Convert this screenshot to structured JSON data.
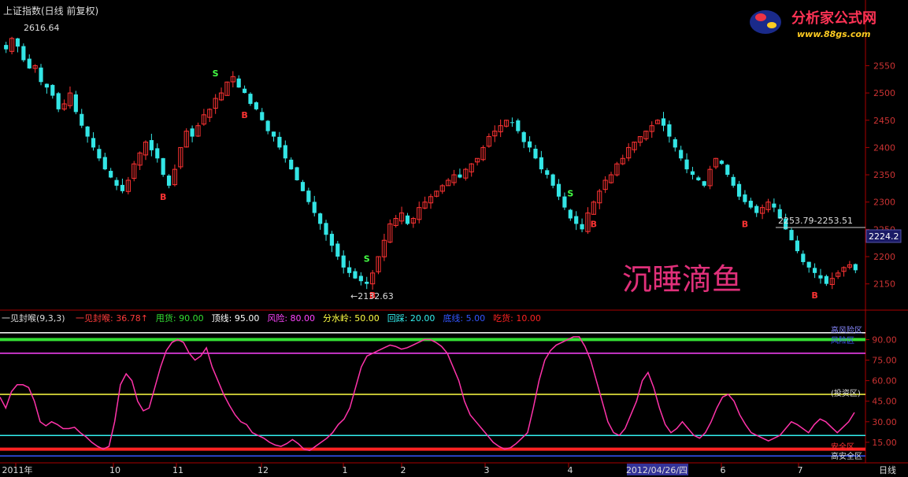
{
  "main": {
    "title": "上证指数(日线 前复权)",
    "high_label": "2616.64",
    "low_label": "←2132.63",
    "crosshair_label": "2253.79-2253.51",
    "current_value": "2224.2",
    "watermark": "沉睡滴鱼"
  },
  "logo": {
    "name": "分析家公式网",
    "url": "www.88gs.com"
  },
  "indicator": {
    "name": "一见封喉(9,3,3)",
    "legend": [
      {
        "label": "一见封喉: 36.78",
        "color": "#ff3b3b",
        "arrow": "↑"
      },
      {
        "label": "甩货: 90.00",
        "color": "#33dd33"
      },
      {
        "label": "顶线: 95.00",
        "color": "#ffffff"
      },
      {
        "label": "风险: 80.00",
        "color": "#ff44ff"
      },
      {
        "label": "分水岭: 50.00",
        "color": "#ffff44"
      },
      {
        "label": "回踩: 20.00",
        "color": "#33eeee"
      },
      {
        "label": "底线: 5.00",
        "color": "#3355ff"
      },
      {
        "label": "吃货: 10.00",
        "color": "#ff2222"
      }
    ],
    "zone_labels": {
      "high_risk": "高风险区",
      "risk": "风险区",
      "invest": "(投资区)",
      "safe": "安全区",
      "high_safe": "高安全区"
    }
  },
  "colors": {
    "up": "#ff3333",
    "down": "#33e5e5",
    "axis": "#aa0000",
    "oscillator": "#ff33aa"
  },
  "chart_data": [
    {
      "type": "candlestick",
      "title": "上证指数(日线 前复权)",
      "ylim": [
        2125,
        2630
      ],
      "yticks": [
        2150,
        2200,
        2250,
        2300,
        2350,
        2400,
        2450,
        2500,
        2550
      ],
      "ytick_labels": [
        "2150",
        "2200",
        "2250",
        "2300",
        "2350",
        "2400",
        "2450",
        "2500",
        "2550"
      ],
      "grid": false,
      "annotations": {
        "high": 2616.64,
        "low": 2132.63,
        "current": 2224.2,
        "crosshair": [
          2253.79,
          2253.51
        ]
      },
      "signals": [
        {
          "type": "S",
          "color": "#44ff44"
        },
        {
          "type": "B",
          "color": "#ff3333"
        }
      ],
      "close": [
        2580,
        2600,
        2585,
        2560,
        2545,
        2550,
        2520,
        2510,
        2495,
        2470,
        2480,
        2500,
        2465,
        2440,
        2420,
        2400,
        2380,
        2360,
        2345,
        2330,
        2320,
        2340,
        2370,
        2390,
        2410,
        2395,
        2380,
        2350,
        2330,
        2360,
        2400,
        2430,
        2420,
        2440,
        2460,
        2470,
        2490,
        2500,
        2520,
        2530,
        2510,
        2500,
        2480,
        2470,
        2450,
        2430,
        2420,
        2400,
        2380,
        2360,
        2340,
        2320,
        2300,
        2280,
        2260,
        2240,
        2220,
        2200,
        2180,
        2170,
        2160,
        2155,
        2150,
        2170,
        2200,
        2230,
        2260,
        2270,
        2280,
        2260,
        2270,
        2290,
        2300,
        2310,
        2320,
        2330,
        2340,
        2350,
        2345,
        2360,
        2370,
        2380,
        2400,
        2420,
        2430,
        2440,
        2450,
        2445,
        2430,
        2410,
        2400,
        2380,
        2360,
        2350,
        2330,
        2310,
        2290,
        2270,
        2260,
        2250,
        2280,
        2300,
        2320,
        2340,
        2350,
        2370,
        2380,
        2400,
        2410,
        2420,
        2430,
        2440,
        2450,
        2440,
        2420,
        2400,
        2380,
        2360,
        2350,
        2340,
        2330,
        2360,
        2380,
        2370,
        2350,
        2330,
        2310,
        2300,
        2290,
        2280,
        2290,
        2300,
        2290,
        2270,
        2250,
        2230,
        2210,
        2190,
        2180,
        2170,
        2160,
        2150,
        2160,
        2170,
        2180,
        2185,
        2175
      ],
      "ohlc_sample_note": ""
    },
    {
      "type": "line",
      "title": "一见封喉(9,3,3)",
      "ylim": [
        0,
        100
      ],
      "yticks": [
        15,
        30,
        45,
        60,
        75,
        90
      ],
      "ytick_labels": [
        "15.00",
        "30.00",
        "45.00",
        "60.00",
        "75.00",
        "90.00"
      ],
      "hlines": [
        {
          "name": "甩货",
          "value": 90,
          "color": "#33dd33"
        },
        {
          "name": "顶线",
          "value": 95,
          "color": "#ffffff"
        },
        {
          "name": "风险",
          "value": 80,
          "color": "#ff44ff"
        },
        {
          "name": "分水岭",
          "value": 50,
          "color": "#ffff44"
        },
        {
          "name": "回踩",
          "value": 20,
          "color": "#33eeee"
        },
        {
          "name": "底线",
          "value": 5,
          "color": "#3355ff"
        },
        {
          "name": "吃货",
          "value": 10,
          "color": "#ff2222"
        }
      ],
      "series": [
        {
          "name": "一见封喉",
          "values": [
            48,
            40,
            52,
            57,
            57,
            55,
            45,
            30,
            27,
            30,
            28,
            25,
            25,
            26,
            22,
            19,
            15,
            12,
            10,
            12,
            30,
            57,
            65,
            60,
            45,
            38,
            40,
            55,
            70,
            82,
            88,
            90,
            88,
            80,
            75,
            78,
            84,
            70,
            60,
            50,
            42,
            35,
            30,
            28,
            22,
            20,
            18,
            15,
            13,
            12,
            14,
            17,
            14,
            10,
            9,
            12,
            15,
            18,
            22,
            28,
            32,
            40,
            55,
            70,
            78,
            80,
            82,
            84,
            86,
            85,
            83,
            84,
            86,
            88,
            90,
            90,
            88,
            85,
            80,
            70,
            60,
            45,
            35,
            30,
            25,
            20,
            15,
            12,
            10,
            11,
            14,
            18,
            22,
            40,
            60,
            75,
            82,
            86,
            88,
            90,
            92,
            92,
            85,
            75,
            60,
            45,
            30,
            22,
            20,
            25,
            35,
            45,
            60,
            66,
            55,
            40,
            28,
            22,
            25,
            30,
            25,
            20,
            18,
            22,
            30,
            40,
            48,
            50,
            45,
            35,
            28,
            22,
            20,
            18,
            16,
            18,
            20,
            25,
            30,
            28,
            25,
            22,
            28,
            32,
            30,
            26,
            22,
            26,
            30,
            36.78
          ]
        }
      ],
      "current": 36.78
    }
  ],
  "x_axis": {
    "labels": [
      "2011年",
      "10",
      "11",
      "12",
      "1",
      "2",
      "3",
      "4",
      "2012/04/26/四",
      "6",
      "7"
    ],
    "period": "日线"
  }
}
